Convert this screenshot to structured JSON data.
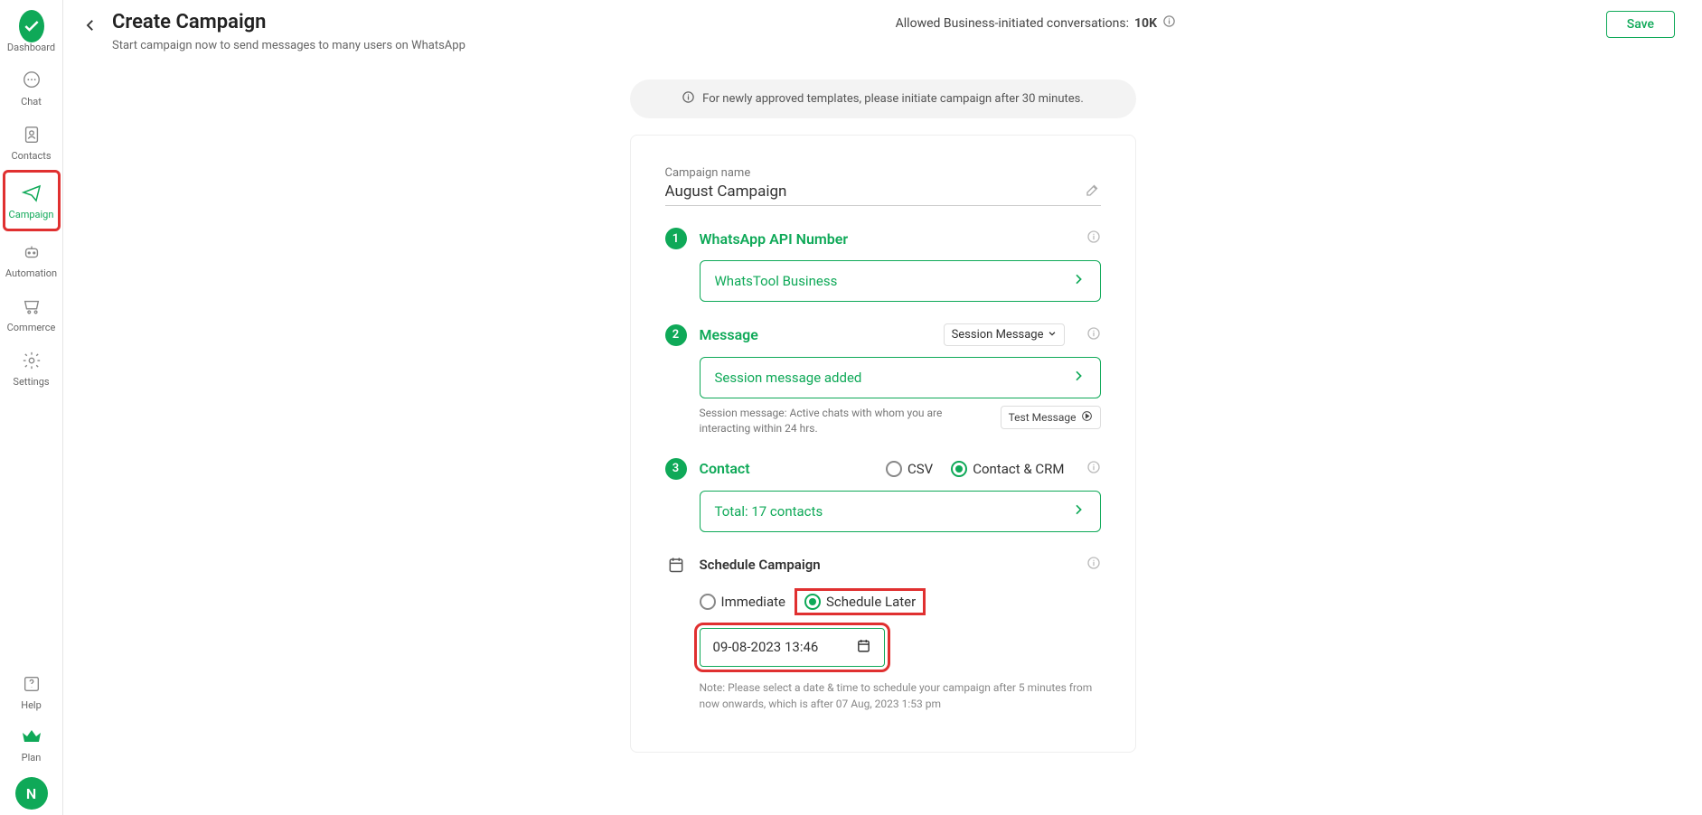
{
  "sidebar": {
    "items": [
      {
        "label": "Dashboard"
      },
      {
        "label": "Chat"
      },
      {
        "label": "Contacts"
      },
      {
        "label": "Campaign"
      },
      {
        "label": "Automation"
      },
      {
        "label": "Commerce"
      },
      {
        "label": "Settings"
      }
    ],
    "help_label": "Help",
    "plan_label": "Plan",
    "avatar_initial": "N"
  },
  "header": {
    "title": "Create Campaign",
    "subtitle": "Start campaign now to send messages to many users on WhatsApp",
    "allowed_prefix": "Allowed Business-initiated conversations: ",
    "allowed_value": "10K",
    "save_label": "Save"
  },
  "notice": {
    "text": "For newly approved templates, please initiate campaign after 30 minutes."
  },
  "campaign_name": {
    "label": "Campaign name",
    "value": "August Campaign"
  },
  "step1": {
    "num": "1",
    "title": "WhatsApp API Number",
    "value": "WhatsTool Business"
  },
  "step2": {
    "num": "2",
    "title": "Message",
    "type_label": "Session Message",
    "value": "Session message added",
    "hint": "Session message: Active chats with whom you are interacting within 24 hrs.",
    "test_label": "Test Message"
  },
  "step3": {
    "num": "3",
    "title": "Contact",
    "csv_label": "CSV",
    "crm_label": "Contact & CRM",
    "value": "Total: 17 contacts"
  },
  "schedule": {
    "title": "Schedule Campaign",
    "immediate_label": "Immediate",
    "later_label": "Schedule Later",
    "datetime_value": "09-08-2023 13:46",
    "note": "Note: Please select a date & time to schedule your campaign after 5 minutes from now onwards, which is after 07 Aug, 2023 1:53 pm"
  }
}
